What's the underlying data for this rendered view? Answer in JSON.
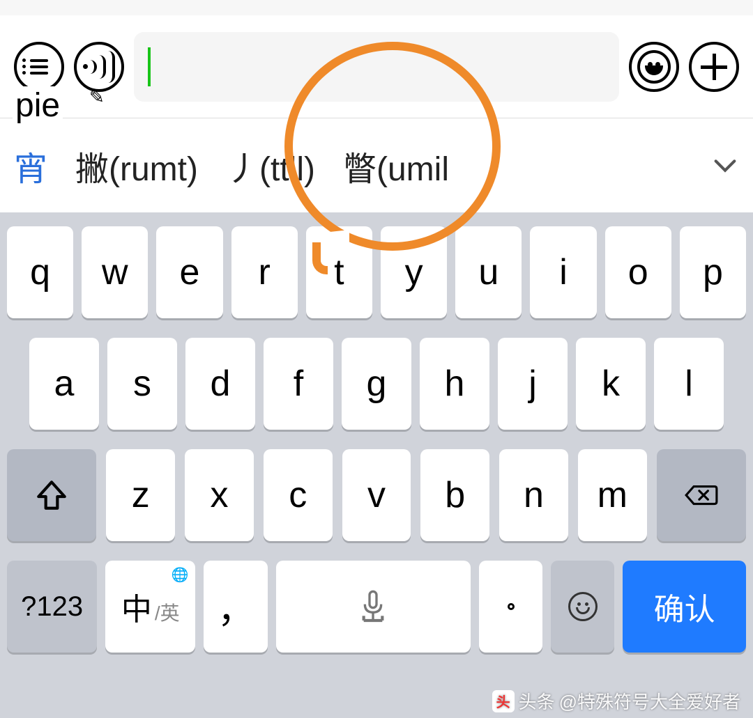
{
  "input": {
    "typed": "pie",
    "value": ""
  },
  "candidates": {
    "primary": "宵",
    "items": [
      "撇(rumt)",
      "丿(ttll)",
      "瞥(umil"
    ]
  },
  "keyboard": {
    "row1": [
      "q",
      "w",
      "e",
      "r",
      "t",
      "y",
      "u",
      "i",
      "o",
      "p"
    ],
    "row2": [
      "a",
      "s",
      "d",
      "f",
      "g",
      "h",
      "j",
      "k",
      "l"
    ],
    "row3": [
      "z",
      "x",
      "c",
      "v",
      "b",
      "n",
      "m"
    ],
    "fn_label": "?123",
    "lang_primary": "中",
    "lang_secondary": "/英",
    "comma": "，",
    "period": "。",
    "confirm": "确认"
  },
  "watermark": {
    "prefix": "头条",
    "text": "@特殊符号大全爱好者"
  },
  "icons": {
    "menu": "menu-list-icon",
    "voice": "voice-icon",
    "emoji": "smile-icon",
    "add": "plus-icon",
    "expand": "chevron-down-icon",
    "shift": "shift-icon",
    "backspace": "backspace-icon",
    "mic": "mic-icon",
    "globe": "globe-icon"
  }
}
